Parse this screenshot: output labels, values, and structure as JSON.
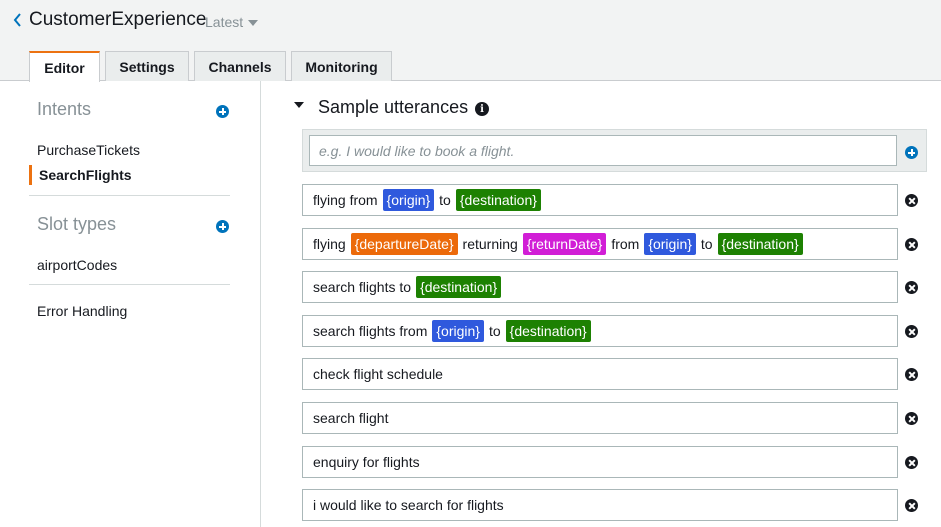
{
  "header": {
    "title": "CustomerExperience",
    "version": "Latest"
  },
  "tabs": [
    {
      "label": "Editor",
      "active": true
    },
    {
      "label": "Settings",
      "active": false
    },
    {
      "label": "Channels",
      "active": false
    },
    {
      "label": "Monitoring",
      "active": false
    }
  ],
  "sidebar": {
    "intents_heading": "Intents",
    "intents": [
      {
        "label": "PurchaseTickets",
        "selected": false
      },
      {
        "label": "SearchFlights",
        "selected": true
      }
    ],
    "slot_types_heading": "Slot types",
    "slot_types": [
      {
        "label": "airportCodes"
      }
    ],
    "error_handling": "Error Handling"
  },
  "main": {
    "section_title": "Sample utterances",
    "info_icon_glyph": "i",
    "placeholder": "e.g. I would like to book a flight.",
    "utterances": [
      [
        {
          "t": "flying from"
        },
        {
          "slot": "{origin}",
          "color": "blue"
        },
        {
          "t": "to"
        },
        {
          "slot": "{destination}",
          "color": "green"
        }
      ],
      [
        {
          "t": "flying"
        },
        {
          "slot": "{departureDate}",
          "color": "orange"
        },
        {
          "t": "returning"
        },
        {
          "slot": "{returnDate}",
          "color": "magenta"
        },
        {
          "t": "from"
        },
        {
          "slot": "{origin}",
          "color": "blue"
        },
        {
          "t": "to"
        },
        {
          "slot": "{destination}",
          "color": "green"
        }
      ],
      [
        {
          "t": "search flights to"
        },
        {
          "slot": "{destination}",
          "color": "green"
        }
      ],
      [
        {
          "t": "search flights from"
        },
        {
          "slot": "{origin}",
          "color": "blue"
        },
        {
          "t": "to"
        },
        {
          "slot": "{destination}",
          "color": "green"
        }
      ],
      [
        {
          "t": "check flight schedule"
        }
      ],
      [
        {
          "t": "search flight"
        }
      ],
      [
        {
          "t": "enquiry for flights"
        }
      ],
      [
        {
          "t": "i would like to search for flights"
        }
      ]
    ]
  },
  "colors": {
    "accent": "#ec7211",
    "primary_blue": "#0073bb",
    "slot_blue": "#2f59dd",
    "slot_green": "#1d8102",
    "slot_orange": "#ec6a0a",
    "slot_magenta": "#d11ed6"
  },
  "icons": {
    "back": "chevron-left-icon",
    "version_dropdown": "caret-down-icon",
    "add": "plus-circle-icon",
    "remove": "x-circle-icon",
    "collapse": "caret-down-icon",
    "info": "info-icon"
  }
}
